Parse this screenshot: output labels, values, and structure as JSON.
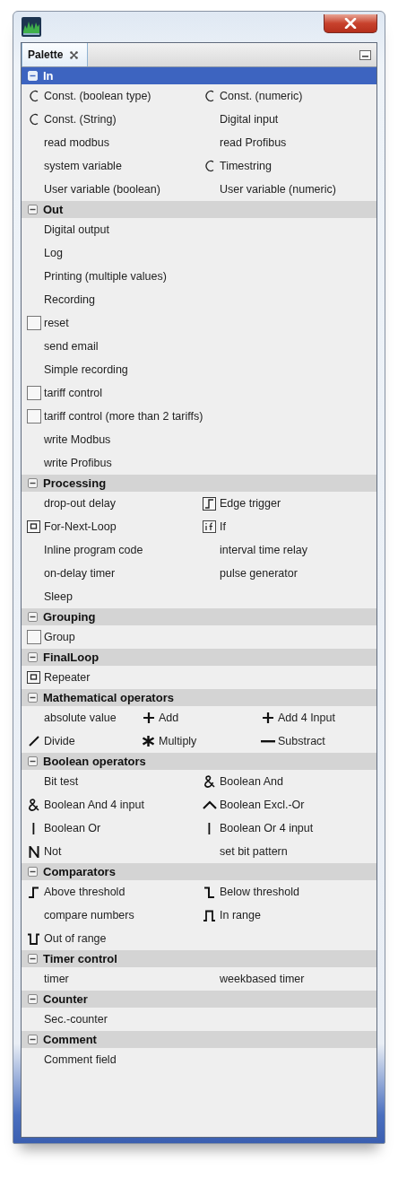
{
  "panel": {
    "tab": "Palette"
  },
  "sections": [
    {
      "title": "In",
      "expanded": true,
      "selected": true,
      "kind": "double",
      "items": [
        {
          "label": "Const. (boolean type)",
          "kind": "constant"
        },
        {
          "label": "Const. (numeric)",
          "kind": "constant"
        },
        {
          "label": "Const. (String)",
          "kind": "constant"
        },
        {
          "label": "Digital input",
          "kind": "plain"
        },
        {
          "label": "read modbus",
          "kind": "plain"
        },
        {
          "label": "read Profibus",
          "kind": "plain"
        },
        {
          "label": "system variable",
          "kind": "plain"
        },
        {
          "label": "Timestring",
          "kind": "constant"
        },
        {
          "label": "User variable (boolean)",
          "kind": "plain"
        },
        {
          "label": "User variable (numeric)",
          "kind": "plain"
        }
      ]
    },
    {
      "title": "Out",
      "expanded": true,
      "selected": false,
      "kind": "single",
      "items": [
        {
          "label": "Digital output",
          "kind": "plain"
        },
        {
          "label": "Log",
          "kind": "plain"
        },
        {
          "label": "Printing (multiple values)",
          "kind": "plain"
        },
        {
          "label": "Recording",
          "kind": "plain"
        },
        {
          "label": "reset",
          "kind": "square"
        },
        {
          "label": "send email",
          "kind": "plain"
        },
        {
          "label": "Simple recording",
          "kind": "plain"
        },
        {
          "label": "tariff control",
          "kind": "square"
        },
        {
          "label": "tariff control (more than 2 tariffs)",
          "kind": "square"
        },
        {
          "label": "write Modbus",
          "kind": "plain"
        },
        {
          "label": "write Profibus",
          "kind": "plain"
        }
      ]
    },
    {
      "title": "Processing",
      "expanded": true,
      "selected": false,
      "kind": "double",
      "items": [
        {
          "label": "drop-out delay",
          "kind": "plain"
        },
        {
          "label": "Edge trigger",
          "kind": "edge"
        },
        {
          "label": "For-Next-Loop",
          "kind": "loop"
        },
        {
          "label": "If",
          "kind": "if"
        },
        {
          "label": "Inline program code",
          "kind": "plain"
        },
        {
          "label": "interval time relay",
          "kind": "plain"
        },
        {
          "label": "on-delay timer",
          "kind": "plain"
        },
        {
          "label": "pulse generator",
          "kind": "plain"
        },
        {
          "label": "Sleep",
          "kind": "plain"
        }
      ]
    },
    {
      "title": "Grouping",
      "expanded": true,
      "selected": false,
      "kind": "single",
      "items": [
        {
          "label": "Group",
          "kind": "square"
        }
      ]
    },
    {
      "title": "FinalLoop",
      "expanded": true,
      "selected": false,
      "kind": "single",
      "items": [
        {
          "label": "Repeater",
          "kind": "loop"
        }
      ]
    },
    {
      "title": "Mathematical operators",
      "expanded": true,
      "selected": false,
      "kind": "triple",
      "items": [
        {
          "label": "absolute value",
          "kind": "plain"
        },
        {
          "label": "Add",
          "kind": "plus"
        },
        {
          "label": "Add 4 Input",
          "kind": "plus"
        },
        {
          "label": "Divide",
          "kind": "slash"
        },
        {
          "label": "Multiply",
          "kind": "asterisk"
        },
        {
          "label": "Substract",
          "kind": "minus"
        }
      ]
    },
    {
      "title": "Boolean operators",
      "expanded": true,
      "selected": false,
      "kind": "double",
      "items": [
        {
          "label": "Bit test",
          "kind": "plain"
        },
        {
          "label": "Boolean And",
          "kind": "ampersand"
        },
        {
          "label": "Boolean And 4 input",
          "kind": "ampersand"
        },
        {
          "label": "Boolean Excl.-Or",
          "kind": "caret"
        },
        {
          "label": "Boolean Or",
          "kind": "bar"
        },
        {
          "label": "Boolean Or 4 input",
          "kind": "bar"
        },
        {
          "label": "Not",
          "kind": "not"
        },
        {
          "label": "set bit pattern",
          "kind": "plain"
        }
      ]
    },
    {
      "title": "Comparators",
      "expanded": true,
      "selected": false,
      "kind": "double",
      "items": [
        {
          "label": "Above threshold",
          "kind": "rise"
        },
        {
          "label": "Below threshold",
          "kind": "fall"
        },
        {
          "label": "compare numbers",
          "kind": "plain"
        },
        {
          "label": "In range",
          "kind": "pulse"
        },
        {
          "label": "Out of range",
          "kind": "notch"
        }
      ]
    },
    {
      "title": "Timer control",
      "expanded": true,
      "selected": false,
      "kind": "double",
      "items": [
        {
          "label": "timer",
          "kind": "plain"
        },
        {
          "label": "weekbased timer",
          "kind": "plain"
        }
      ]
    },
    {
      "title": "Counter",
      "expanded": true,
      "selected": false,
      "kind": "single",
      "items": [
        {
          "label": "Sec.-counter",
          "kind": "plain"
        }
      ]
    },
    {
      "title": "Comment",
      "expanded": true,
      "selected": false,
      "kind": "single",
      "items": [
        {
          "label": "Comment field",
          "kind": "plain"
        }
      ]
    }
  ]
}
